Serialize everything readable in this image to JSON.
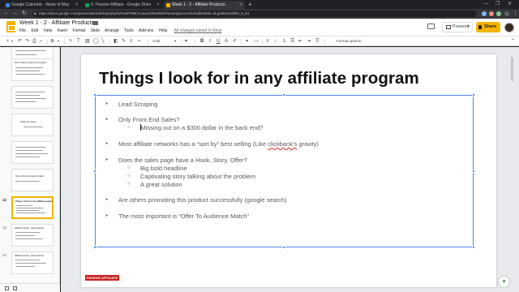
{
  "browser": {
    "tabs": [
      {
        "label": "Google Calendar - Week of May",
        "favicon_color": "#4285f4"
      },
      {
        "label": "0. Passive Affiliate - Google Drive",
        "favicon_color": "#0f9d58"
      },
      {
        "label": "Week 1 - 2 - Affiliate Products",
        "favicon_color": "#f4b400"
      }
    ],
    "new_tab": "+",
    "url": "https://docs.google.com/presentation/d/1NpluKjzkZVu6I7RBCKJaqAZkGaRZhTamuHpQUcAzKe/edit#slide=id.g336c04d0b0_0_51"
  },
  "doc": {
    "title": "Week 1 - 2 - Affiliate Products",
    "menu": [
      "File",
      "Edit",
      "View",
      "Insert",
      "Format",
      "Slide",
      "Arrange",
      "Tools",
      "Add-ons",
      "Help"
    ],
    "saved_status": "All changes saved in Drive",
    "present_label": "Present",
    "share_label": "Share"
  },
  "toolbar": {
    "font": "Arial",
    "font_caret": "▾",
    "format_options": "Format options..."
  },
  "filmstrip": {
    "slides": [
      {
        "num": "",
        "text": ""
      },
      {
        "num": "",
        "text": "Some different ways to do research"
      },
      {
        "num": "",
        "text": ""
      },
      {
        "num": "",
        "text": "Follow the money"
      },
      {
        "num": "",
        "text": ""
      },
      {
        "num": "",
        "text": "How to find the people to follow"
      },
      {
        "num": "12",
        "text": "Things I look for in any affiliate program"
      },
      {
        "num": "13",
        "text": "Affiliate Products - Niche Example"
      },
      {
        "num": "14",
        "text": "Affiliate Products - Niche Example"
      }
    ]
  },
  "slide": {
    "title": "Things I look for in any affiliate program",
    "bullets": [
      {
        "level": 1,
        "text": "Lead Scraping"
      },
      {
        "level": 1,
        "text": "Only Front End Sales?"
      },
      {
        "level": 2,
        "text": "Missing out on a $300 dollar in the back end?"
      },
      {
        "level": 1,
        "text_before": "Most affiliate networks has a “sort by” best selling (Like ",
        "text_link": "clickbank’s",
        "text_after": " gravity)"
      },
      {
        "level": 1,
        "text": "Does the sales page have a Hook, Story, Offer?"
      },
      {
        "level": 2,
        "text": "Big bold headline"
      },
      {
        "level": 2,
        "text": "Captivating story talking about the problem"
      },
      {
        "level": 2,
        "text": "A great solution"
      },
      {
        "level": 1,
        "text": "Are others promoting this product successfully (google search)"
      },
      {
        "level": 1,
        "text": "The most important is “Offer To Audience Match”"
      }
    ],
    "footer_logo": "PASSIVE AFFILIATE"
  },
  "colors": {
    "accent": "#f4b400",
    "selection": "#4a86e8",
    "logo_red": "#cc1f1f"
  }
}
